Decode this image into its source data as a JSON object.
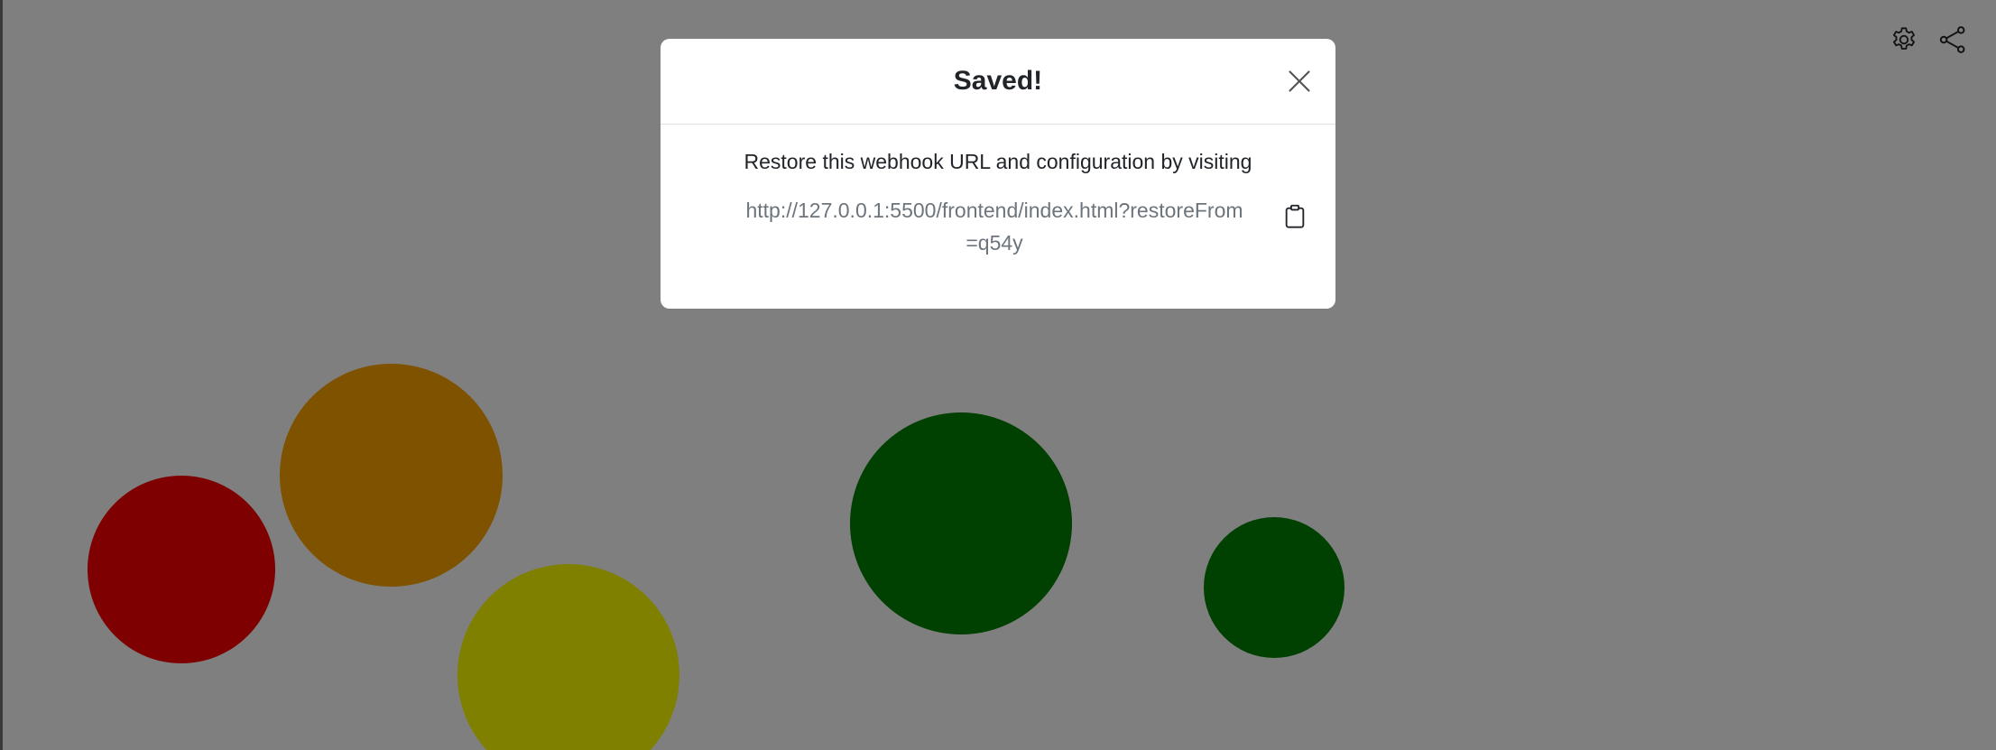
{
  "toolbar": {
    "settings_icon": "gear-icon",
    "share_icon": "share-icon"
  },
  "bubbles": [
    {
      "name": "red",
      "color": "#ff0000"
    },
    {
      "name": "orange",
      "color": "#ffa500"
    },
    {
      "name": "yellow",
      "color": "#ffff00"
    },
    {
      "name": "green-large",
      "color": "#008000"
    },
    {
      "name": "green-small",
      "color": "#008000"
    }
  ],
  "modal": {
    "title": "Saved!",
    "close_icon": "close-icon",
    "message": "Restore this webhook URL and configuration by visiting",
    "restore_url": "http://127.0.0.1:5500/frontend/index.html?restoreFrom=q54y",
    "copy_icon": "clipboard-icon"
  },
  "colors": {
    "backdrop": "rgba(0,0,0,0.5)",
    "modal_background": "#ffffff",
    "title_text": "#212529",
    "url_text": "#6c757d"
  }
}
